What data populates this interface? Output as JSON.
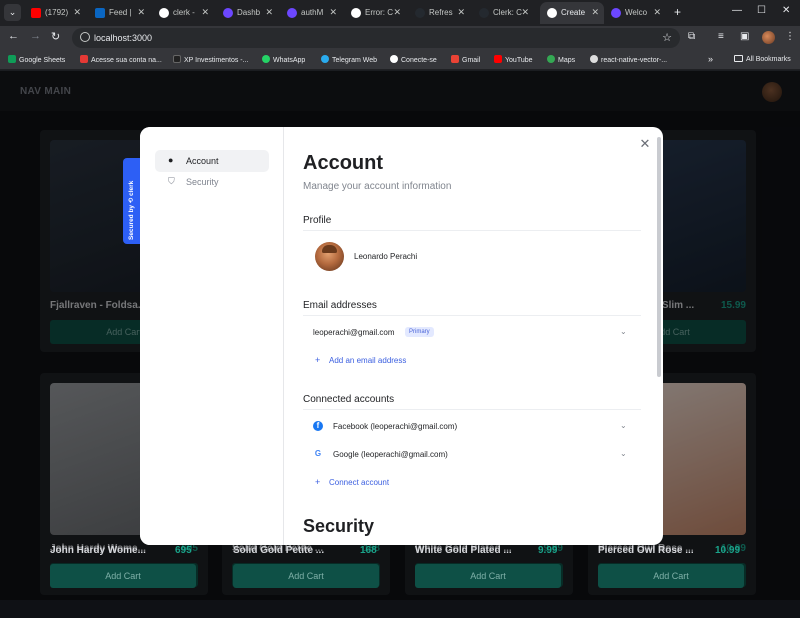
{
  "browser": {
    "tabs": [
      {
        "label": "(1792)",
        "favicon": "youtube-icon",
        "color": "#ff0000"
      },
      {
        "label": "Feed | ",
        "favicon": "linkedin-icon",
        "color": "#0a66c2"
      },
      {
        "label": "clerk - ",
        "favicon": "google-icon",
        "color": "#4285f4"
      },
      {
        "label": "Dashb",
        "favicon": "clerk-icon",
        "color": "#6c47ff"
      },
      {
        "label": "authM",
        "favicon": "clerk-icon",
        "color": "#6c47ff"
      },
      {
        "label": "Error: C",
        "favicon": "google-icon",
        "color": "#4285f4"
      },
      {
        "label": "Refres",
        "favicon": "github-icon",
        "color": "#24292f"
      },
      {
        "label": "Clerk: C",
        "favicon": "github-icon",
        "color": "#24292f"
      },
      {
        "label": "Create",
        "favicon": "vercel-icon",
        "color": "#ffffff",
        "active": true
      },
      {
        "label": "Welco",
        "favicon": "clerk-icon",
        "color": "#6c47ff"
      }
    ],
    "url": "localhost:3000",
    "bookmarks": [
      {
        "label": "Google Sheets",
        "color": "#0f9d58"
      },
      {
        "label": "Acesse sua conta na...",
        "color": "#e53935"
      },
      {
        "label": "XP Investimentos -...",
        "color": "#222222"
      },
      {
        "label": "WhatsApp",
        "color": "#25d366"
      },
      {
        "label": "Telegram Web",
        "color": "#2aabee"
      },
      {
        "label": "Conecte-se",
        "color": "#ffffff"
      },
      {
        "label": "Gmail",
        "color": "#ea4335"
      },
      {
        "label": "YouTube",
        "color": "#ff0000"
      },
      {
        "label": "Maps",
        "color": "#34a853"
      },
      {
        "label": "react-native-vector-...",
        "color": "#dddddd"
      }
    ],
    "all_bookmarks": "All Bookmarks"
  },
  "app": {
    "nav_title": "NAV MAIN",
    "products": [
      {
        "title": "Fjallraven - Foldsa...",
        "price": "",
        "button": "Add Cart"
      },
      {
        "title": "Mens Casual Slim ...",
        "price": "15.99",
        "button": "Add Cart"
      },
      {
        "title": "John Hardy Wome...",
        "price": "695",
        "button": "Add Cart"
      },
      {
        "title": "Solid Gold Petite ...",
        "price": "168",
        "button": "Add Cart"
      },
      {
        "title": "White Gold Plated ...",
        "price": "9.99",
        "button": "Add Cart"
      },
      {
        "title": "Pierced Owl Rose ...",
        "price": "10.99",
        "button": "Add Cart"
      }
    ],
    "visible_cart_button": "Add Cart"
  },
  "modal": {
    "nav": {
      "account": "Account",
      "security": "Security"
    },
    "secured_by": "Secured by ⟲ clerk",
    "title": "Account",
    "subtitle": "Manage your account information",
    "profile": {
      "heading": "Profile",
      "name": "Leonardo Perachi"
    },
    "email": {
      "heading": "Email addresses",
      "address": "leoperachi@gmail.com",
      "badge": "Primary",
      "add_label": "Add an email address"
    },
    "connected": {
      "heading": "Connected accounts",
      "facebook": "Facebook (leoperachi@gmail.com)",
      "google": "Google (leoperachi@gmail.com)",
      "connect_label": "Connect account"
    },
    "security_title": "Security"
  },
  "colors": {
    "accent": "#3b5fe0",
    "clerk_badge": "#2d5ff5",
    "price": "#1aa38a",
    "cart_button": "#0e5046"
  }
}
